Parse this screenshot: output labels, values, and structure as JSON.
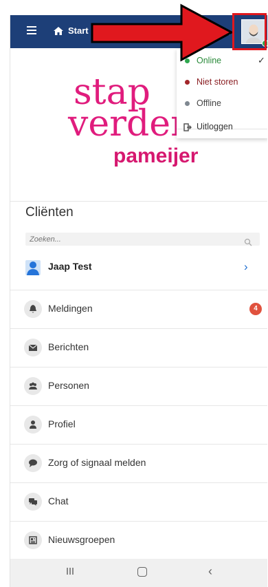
{
  "navbar": {
    "start_label": "Start",
    "menu_icon": "hamburger-menu-icon",
    "home_icon": "home-icon",
    "cloud_icon": "cloud-icon",
    "bg_color": "#1d3f78"
  },
  "banner": {
    "logo_line1": "stap",
    "logo_line2": "verder",
    "logo_line3": "pameijer",
    "logo_color": "#e01c7d"
  },
  "status_menu": {
    "items": [
      {
        "label": "Online",
        "color": "#2fa84f",
        "checked": true
      },
      {
        "label": "Niet storen",
        "color": "#a3262a"
      },
      {
        "label": "Offline",
        "color": "#7f8891"
      }
    ],
    "logout_label": "Uitloggen"
  },
  "clients": {
    "title": "Cliënten",
    "search_placeholder": "Zoeken...",
    "selected_client": "Jaap Test"
  },
  "menu": [
    {
      "label": "Meldingen",
      "icon": "bell-icon",
      "badge": "4"
    },
    {
      "label": "Berichten",
      "icon": "envelope-icon"
    },
    {
      "label": "Personen",
      "icon": "people-icon"
    },
    {
      "label": "Profiel",
      "icon": "user-icon"
    },
    {
      "label": "Zorg of signaal melden",
      "icon": "comment-icon"
    },
    {
      "label": "Chat",
      "icon": "chat-icon"
    },
    {
      "label": "Nieuwsgroepen",
      "icon": "newspaper-icon"
    }
  ],
  "colors": {
    "accent": "#1f6fd1",
    "badge": "#e0523e",
    "annotation": "#e0181e"
  }
}
